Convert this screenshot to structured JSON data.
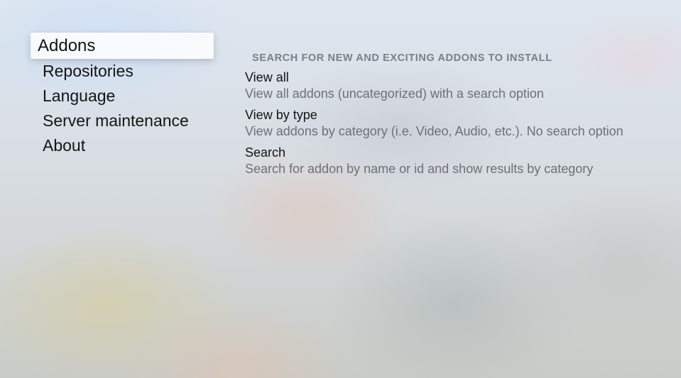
{
  "sidebar": {
    "items": [
      {
        "label": "Addons",
        "selected": true
      },
      {
        "label": "Repositories",
        "selected": false
      },
      {
        "label": "Language",
        "selected": false
      },
      {
        "label": "Server maintenance",
        "selected": false
      },
      {
        "label": "About",
        "selected": false
      }
    ]
  },
  "main": {
    "section_header": "SEARCH FOR NEW AND EXCITING ADDONS TO INSTALL",
    "options": [
      {
        "title": "View all",
        "description": "View all addons (uncategorized) with a search option"
      },
      {
        "title": "View by type",
        "description": "View addons by category (i.e. Video, Audio, etc.). No search option"
      },
      {
        "title": "Search",
        "description": "Search for addon by name or id and show results by category"
      }
    ]
  },
  "colors": {
    "selected_background": "#fafbfd",
    "primary_text": "#141414",
    "secondary_text": "#6e7075",
    "header_text": "#7b7f86"
  }
}
